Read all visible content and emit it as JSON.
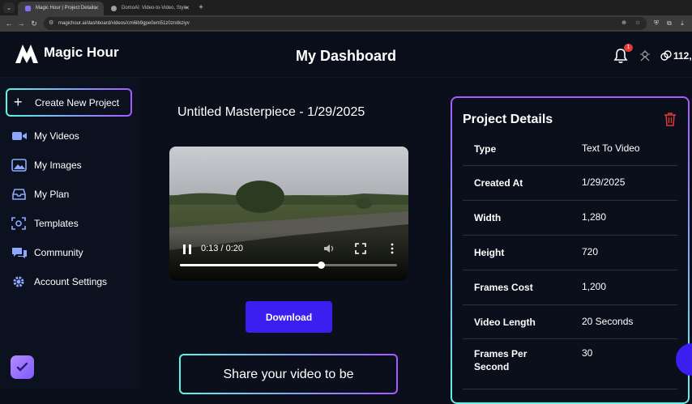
{
  "browser": {
    "tabs": [
      {
        "title": "Magic Hour | Project Details",
        "active": true
      },
      {
        "title": "DomoAI: Video-to-Video, Style",
        "active": false
      }
    ],
    "url": "magichour.ai/dashboard/videos/cm6ib9gpe0em51z0zrxtkziyv"
  },
  "header": {
    "brand": "Magic Hour",
    "title": "My Dashboard",
    "notification_count": "1",
    "credits": "112,"
  },
  "sidebar": {
    "create_label": "Create New Project",
    "items": [
      {
        "label": "My Videos",
        "icon": "video-camera-icon"
      },
      {
        "label": "My Images",
        "icon": "image-icon"
      },
      {
        "label": "My Plan",
        "icon": "inbox-icon"
      },
      {
        "label": "Templates",
        "icon": "scan-icon"
      },
      {
        "label": "Community",
        "icon": "chat-icon"
      },
      {
        "label": "Account Settings",
        "icon": "gear-icon"
      }
    ]
  },
  "main": {
    "project_title": "Untitled Masterpiece - 1/29/2025",
    "player": {
      "time": "0:13 / 0:20",
      "progress": 0.65
    },
    "download_label": "Download",
    "share_text": "Share your video to be"
  },
  "details": {
    "title": "Project Details",
    "rows": [
      {
        "key": "Type",
        "value": "Text To Video"
      },
      {
        "key": "Created At",
        "value": "1/29/2025"
      },
      {
        "key": "Width",
        "value": "1,280"
      },
      {
        "key": "Height",
        "value": "720"
      },
      {
        "key": "Frames Cost",
        "value": "1,200"
      },
      {
        "key": "Video Length",
        "value": "20 Seconds"
      },
      {
        "key": "Frames Per Second",
        "value": "30"
      }
    ]
  },
  "colors": {
    "accent": "#3a1ff0",
    "gradient_start": "#5ff5e6",
    "gradient_end": "#a25bff",
    "danger": "#e53935"
  }
}
